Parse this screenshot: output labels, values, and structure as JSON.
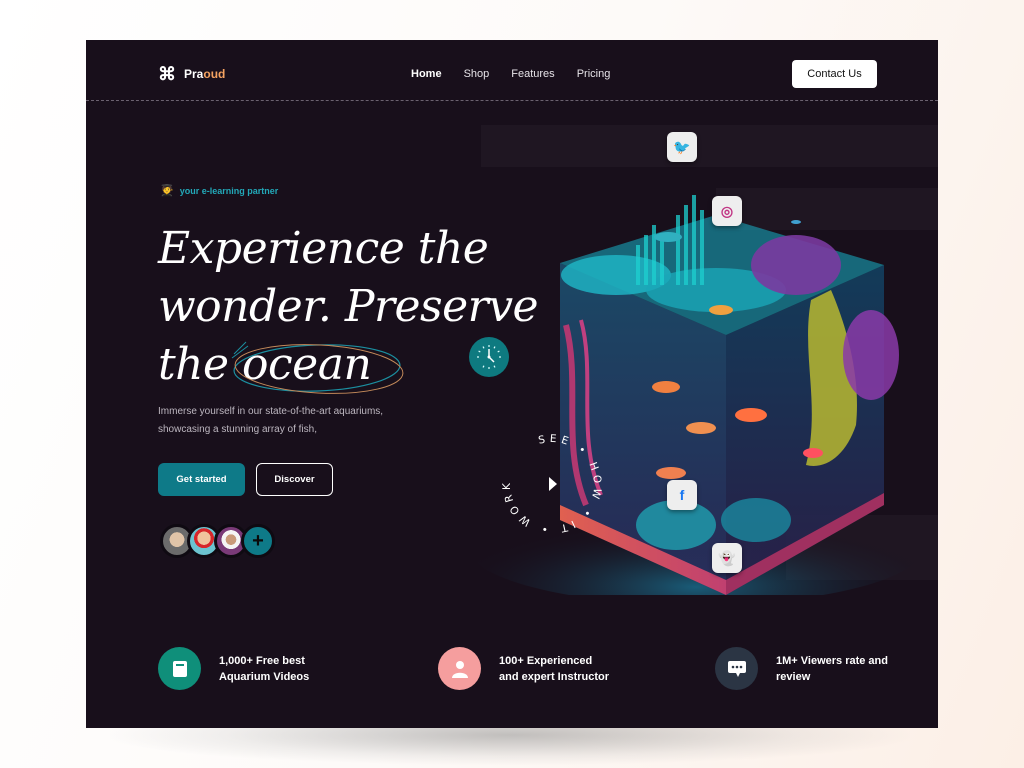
{
  "brand": {
    "prefix": "Pra",
    "accent": "oud",
    "icon": "command-icon",
    "accent_color": "#f4a261"
  },
  "nav": {
    "links": [
      {
        "label": "Home",
        "active": true
      },
      {
        "label": "Shop",
        "active": false
      },
      {
        "label": "Features",
        "active": false
      },
      {
        "label": "Pricing",
        "active": false
      }
    ],
    "contact_label": "Contact Us"
  },
  "hero": {
    "tagline": "your e-learning partner",
    "tagline_icon": "graduate-emoji-icon",
    "headline_line1": "Experience the",
    "headline_line2": "wonder. Preserve",
    "headline_line3_prefix": "the ",
    "headline_highlight": "ocean",
    "subtitle": "Immerse yourself in our state-of-the-art aquariums, showcasing a stunning array of fish,",
    "primary_button": "Get started",
    "secondary_button": "Discover",
    "avatars": [
      "avatar-man-glasses",
      "avatar-man-red-shirt",
      "avatar-woman-hijab"
    ],
    "avatar_add_label": "+",
    "circular_text": "SEE • HOW • IT • WORKS •",
    "accent_color": "#0e7a88"
  },
  "social": [
    {
      "name": "twitter",
      "glyph": "🐦",
      "color": "#1d9bf0"
    },
    {
      "name": "instagram",
      "glyph": "◎",
      "color": "#c13584"
    },
    {
      "name": "facebook",
      "glyph": "f",
      "color": "#1877f2"
    },
    {
      "name": "snapchat",
      "glyph": "👻",
      "color": "#fffc00"
    }
  ],
  "stats": [
    {
      "line1": "1,000+ Free best",
      "line2": "Aquarium Videos",
      "icon": "book-icon",
      "color": "#0f8f7a"
    },
    {
      "line1": "100+ Experienced",
      "line2": "and expert Instructor",
      "icon": "user-icon",
      "color": "#f59e9e"
    },
    {
      "line1": "1M+ Viewers rate and",
      "line2": "review",
      "icon": "chat-icon",
      "color": "#2b3544"
    }
  ]
}
